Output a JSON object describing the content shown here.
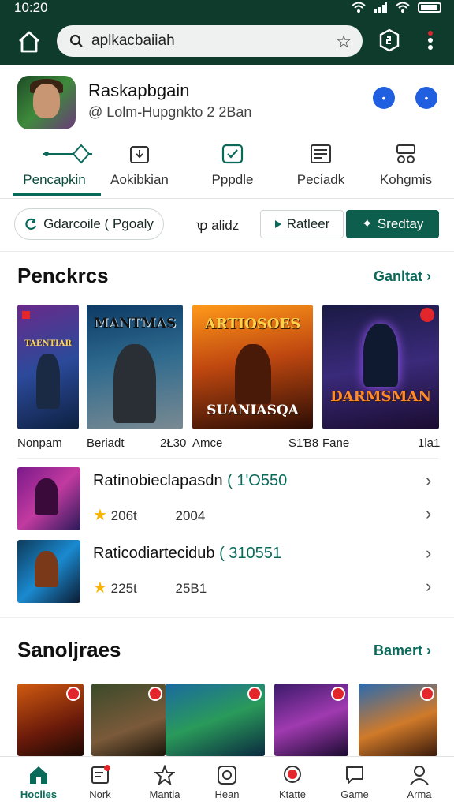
{
  "status_bar": {
    "time": "10:20"
  },
  "browser": {
    "url": "aplkacbaiiah"
  },
  "app": {
    "title": "Raskapbgain",
    "subtitle": "@ Lolm-Hupgnkto 2 2Ban"
  },
  "tabs": [
    {
      "label": "Pencapkin",
      "icon": "diamond-icon"
    },
    {
      "label": "Aokibkian",
      "icon": "download-icon"
    },
    {
      "label": "Pppdle",
      "icon": "check-icon"
    },
    {
      "label": "Peciadk",
      "icon": "news-icon"
    },
    {
      "label": "Kohgmis",
      "icon": "controller-icon"
    }
  ],
  "filters": {
    "chip1": "Gdarcoile ( Pgoaly",
    "chip2": "ꝕ alidz",
    "button1": "Ratleer",
    "button2": "Sredtay"
  },
  "section1": {
    "title": "Penckrcs",
    "link": "Ganltat",
    "cards": [
      {
        "caption": "Nonpam",
        "art": "TAENTIAR"
      },
      {
        "caption": "Beriadt",
        "value": "2Ł30",
        "art": "MANTMAS"
      },
      {
        "caption": "Amce",
        "value": "S1Ɓ8",
        "art": "SUANIASQA"
      },
      {
        "caption": "Fane",
        "value": "1la1",
        "art": "DARMSMAN"
      }
    ]
  },
  "list": [
    {
      "title": "Ratinobieclapasdn",
      "number": "( 1'O550",
      "rating": "206t",
      "year": "2004"
    },
    {
      "title": "Raticodiartecidub",
      "number": "( 310551",
      "rating": "225t",
      "year": "25B1"
    }
  ],
  "section2": {
    "title": "Sanoljraes",
    "link": "Bamert"
  },
  "bottom_nav": [
    {
      "label": "Hoclies",
      "icon": "home-icon"
    },
    {
      "label": "Nork",
      "icon": "note-icon"
    },
    {
      "label": "Mantia",
      "icon": "star-icon"
    },
    {
      "label": "Hean",
      "icon": "instagram-icon"
    },
    {
      "label": "Ktatte",
      "icon": "location-icon"
    },
    {
      "label": "Game",
      "icon": "chat-icon"
    },
    {
      "label": "Arma",
      "icon": "person-icon"
    }
  ],
  "colors": {
    "brand_dark": "#0e3b2b",
    "accent": "#0a6a5a",
    "link_blue": "#1f5fe0"
  }
}
